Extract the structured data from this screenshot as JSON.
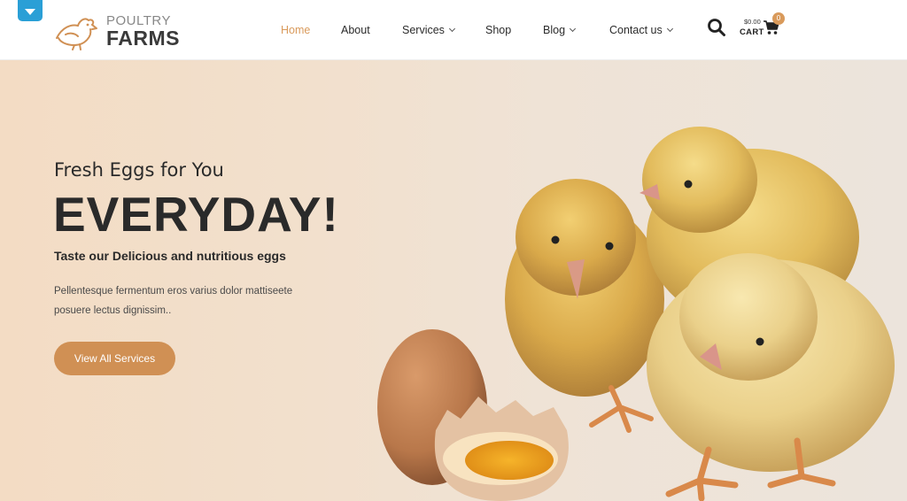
{
  "header": {
    "logo": {
      "line1": "POULTRY",
      "line2": "FARMS"
    },
    "nav": [
      {
        "label": "Home",
        "active": true,
        "dropdown": false
      },
      {
        "label": "About",
        "active": false,
        "dropdown": false
      },
      {
        "label": "Services",
        "active": false,
        "dropdown": true
      },
      {
        "label": "Shop",
        "active": false,
        "dropdown": false
      },
      {
        "label": "Blog",
        "active": false,
        "dropdown": true
      },
      {
        "label": "Contact us",
        "active": false,
        "dropdown": true
      }
    ],
    "cart": {
      "amount": "$0.00",
      "label": "CART",
      "count": "0"
    }
  },
  "hero": {
    "pre_title": "Fresh Eggs for You",
    "title": "EVERYDAY!",
    "subtitle": "Taste our Delicious and nutritious eggs",
    "description": "Pellentesque fermentum eros varius dolor mattiseete posuere lectus dignissim..",
    "cta_label": "View All Services"
  },
  "colors": {
    "accent": "#d99a5b",
    "button": "#d09054",
    "topbar_tab": "#2a9fd6"
  }
}
